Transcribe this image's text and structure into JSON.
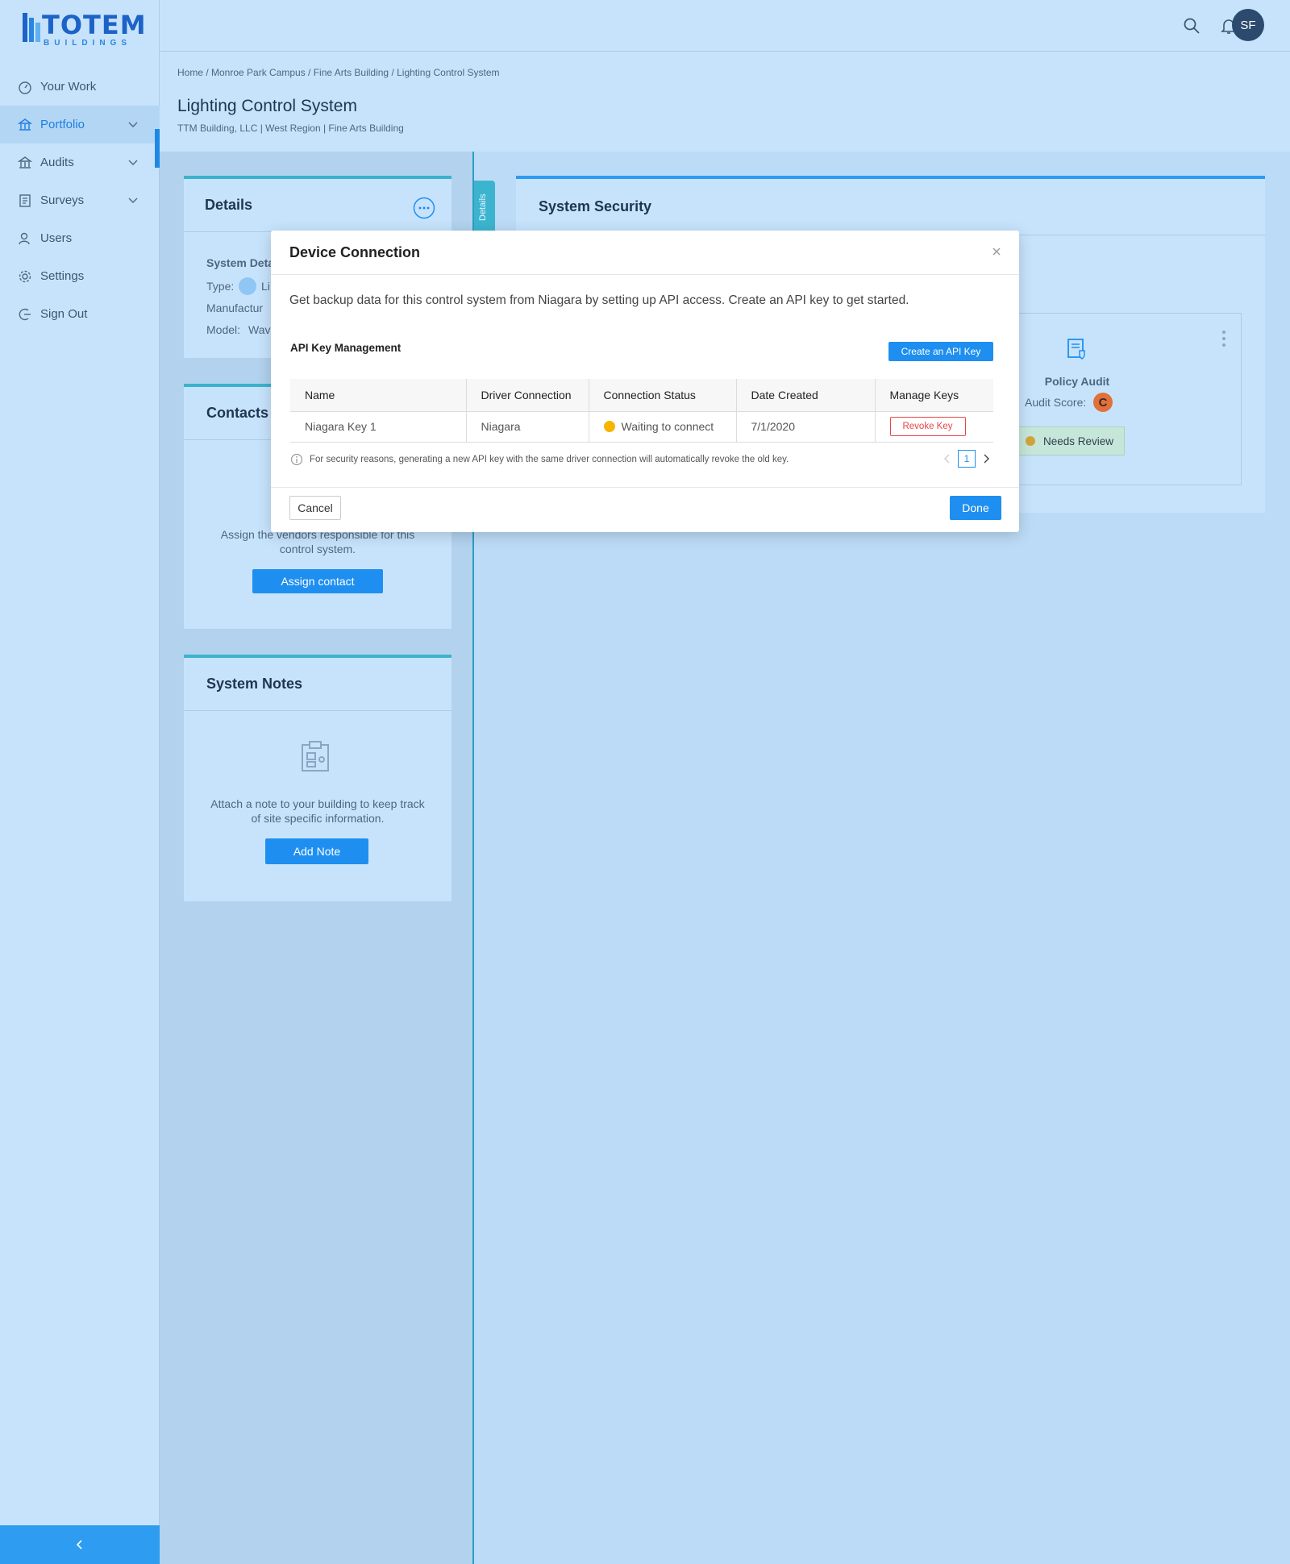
{
  "brand": {
    "name": "TOTEM",
    "sub": "BUILDINGS"
  },
  "sidebar": {
    "items": [
      {
        "label": "Your Work"
      },
      {
        "label": "Portfolio"
      },
      {
        "label": "Audits"
      },
      {
        "label": "Surveys"
      },
      {
        "label": "Users"
      },
      {
        "label": "Settings"
      },
      {
        "label": "Sign Out"
      }
    ]
  },
  "header": {
    "avatar_initials": "SF"
  },
  "page": {
    "breadcrumb": "Home / Monroe Park Campus / Fine Arts Building / Lighting Control System",
    "title": "Lighting Control System",
    "subtitle": "TTM Building, LLC | West Region | Fine Arts Building"
  },
  "details_tab": "Details",
  "details_card": {
    "title": "Details",
    "section": "System Deta",
    "type_label": "Type:",
    "type_value": "Li",
    "manufacturer_label": "Manufactur",
    "model_label": "Model:",
    "model_value": "Wav"
  },
  "contacts_card": {
    "title": "Contacts",
    "desc_line1": "Assign the vendors responsible for this",
    "desc_line2": "control system.",
    "button": "Assign contact"
  },
  "notes_card": {
    "title": "System Notes",
    "desc_line1": "Attach a note to your building to keep track",
    "desc_line2": "of site specific information.",
    "button": "Add Note"
  },
  "security_card": {
    "title": "System Security",
    "policy_title": "Policy Audit",
    "audit_score_label": "Audit Score:",
    "audit_grade": "C",
    "status": "Needs Review"
  },
  "modal": {
    "title": "Device Connection",
    "description": "Get backup data for this control system from Niagara by setting up API access. Create an API key to get started.",
    "section_label": "API Key Management",
    "create_button": "Create an API Key",
    "columns": [
      "Name",
      "Driver Connection",
      "Connection Status",
      "Date Created",
      "Manage Keys"
    ],
    "rows": [
      {
        "name": "Niagara Key 1",
        "driver": "Niagara",
        "status": "Waiting to connect",
        "date": "7/1/2020",
        "action": "Revoke Key"
      }
    ],
    "info_note": "For security reasons, generating a new API key with the same driver connection will automatically revoke the old key.",
    "page": "1",
    "cancel": "Cancel",
    "done": "Done"
  },
  "colors": {
    "accent": "#1e8ff0",
    "teal": "#3bb3cc",
    "danger": "#e64545",
    "warning": "#f7b500",
    "grade": "#e2703a"
  }
}
